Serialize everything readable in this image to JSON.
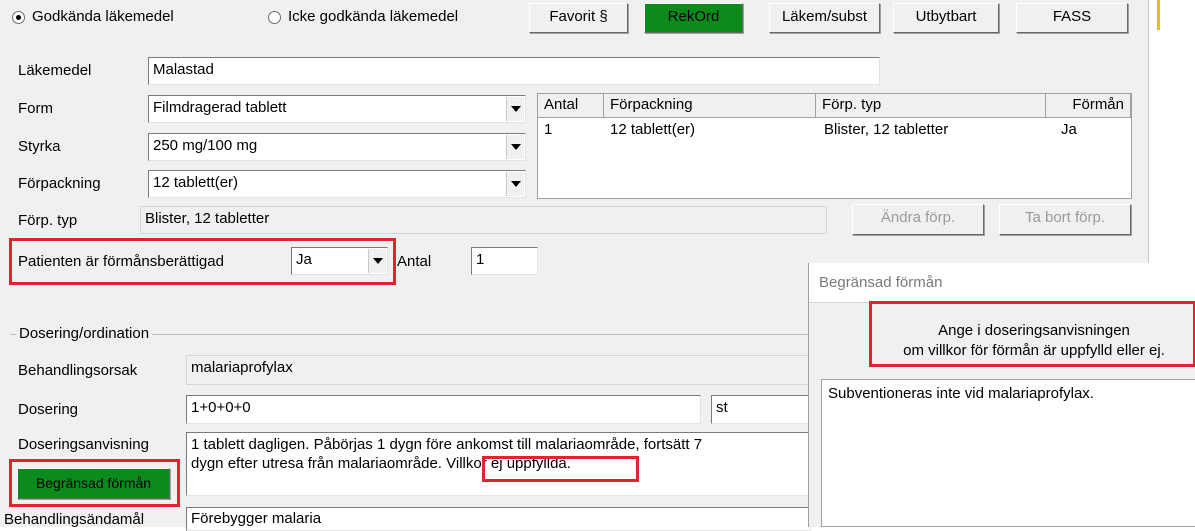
{
  "top": {
    "radio_approved": "Godkända läkemedel",
    "radio_not_approved": "Icke godkända läkemedel",
    "btn_favorit": "Favorit §",
    "btn_rekord": "RekOrd",
    "btn_lakem": "Läkem/subst",
    "btn_utbytbart": "Utbytbart",
    "btn_fass": "FASS"
  },
  "drug": {
    "lakemedel_label": "Läkemedel",
    "lakemedel_value": "Malastad",
    "form_label": "Form",
    "form_value": "Filmdragerad tablett",
    "styrka_label": "Styrka",
    "styrka_value": "250 mg/100 mg",
    "forpackning_label": "Förpackning",
    "forpackning_value": "12 tablett(er)",
    "forp_typ_label": "Förp. typ",
    "forp_typ_value": "Blister, 12 tabletter",
    "btn_andra_forp": "Ändra förp.",
    "btn_ta_bort_forp": "Ta bort förp."
  },
  "package_table": {
    "headers": [
      "Antal",
      "Förpackning",
      "Förp. typ",
      "Förmån"
    ],
    "rows": [
      [
        "1",
        "12 tablett(er)",
        "Blister, 12 tabletter",
        "Ja"
      ]
    ]
  },
  "benefit": {
    "label": "Patienten är förmånsberättigad",
    "value": "Ja",
    "antal_label": "Antal",
    "antal_value": "1"
  },
  "dosering": {
    "group_title": "Dosering/ordination",
    "behandlingsorsak_label": "Behandlingsorsak",
    "behandlingsorsak_value": "malariaprofylax",
    "dosering_label": "Dosering",
    "dosering_value": "1+0+0+0",
    "dosering_unit": "st",
    "anvisning_label": "Doseringsanvisning",
    "anvisning_line1": "1 tablett dagligen. Påbörjas 1 dygn före ankomst till malariaområde, fortsätt 7",
    "anvisning_line2": "dygn efter utresa från malariaområde.",
    "anvisning_highlight": "Villkor ej uppfyllda.",
    "btn_begransad": "Begränsad förmån",
    "andamal_label": "Behandlingsändamål",
    "andamal_value": "Förebygger malaria"
  },
  "dialog": {
    "title": "Begränsad förmån",
    "instruction_line1": "Ange i doseringsanvisningen",
    "instruction_line2": "om villkor för förmån är uppfylld eller ej.",
    "text": "Subventioneras inte vid malariaprofylax."
  },
  "colors": {
    "green_button": "#0c8a1c",
    "highlight_border": "#e0232e",
    "window_bg": "#f0f0f0"
  }
}
